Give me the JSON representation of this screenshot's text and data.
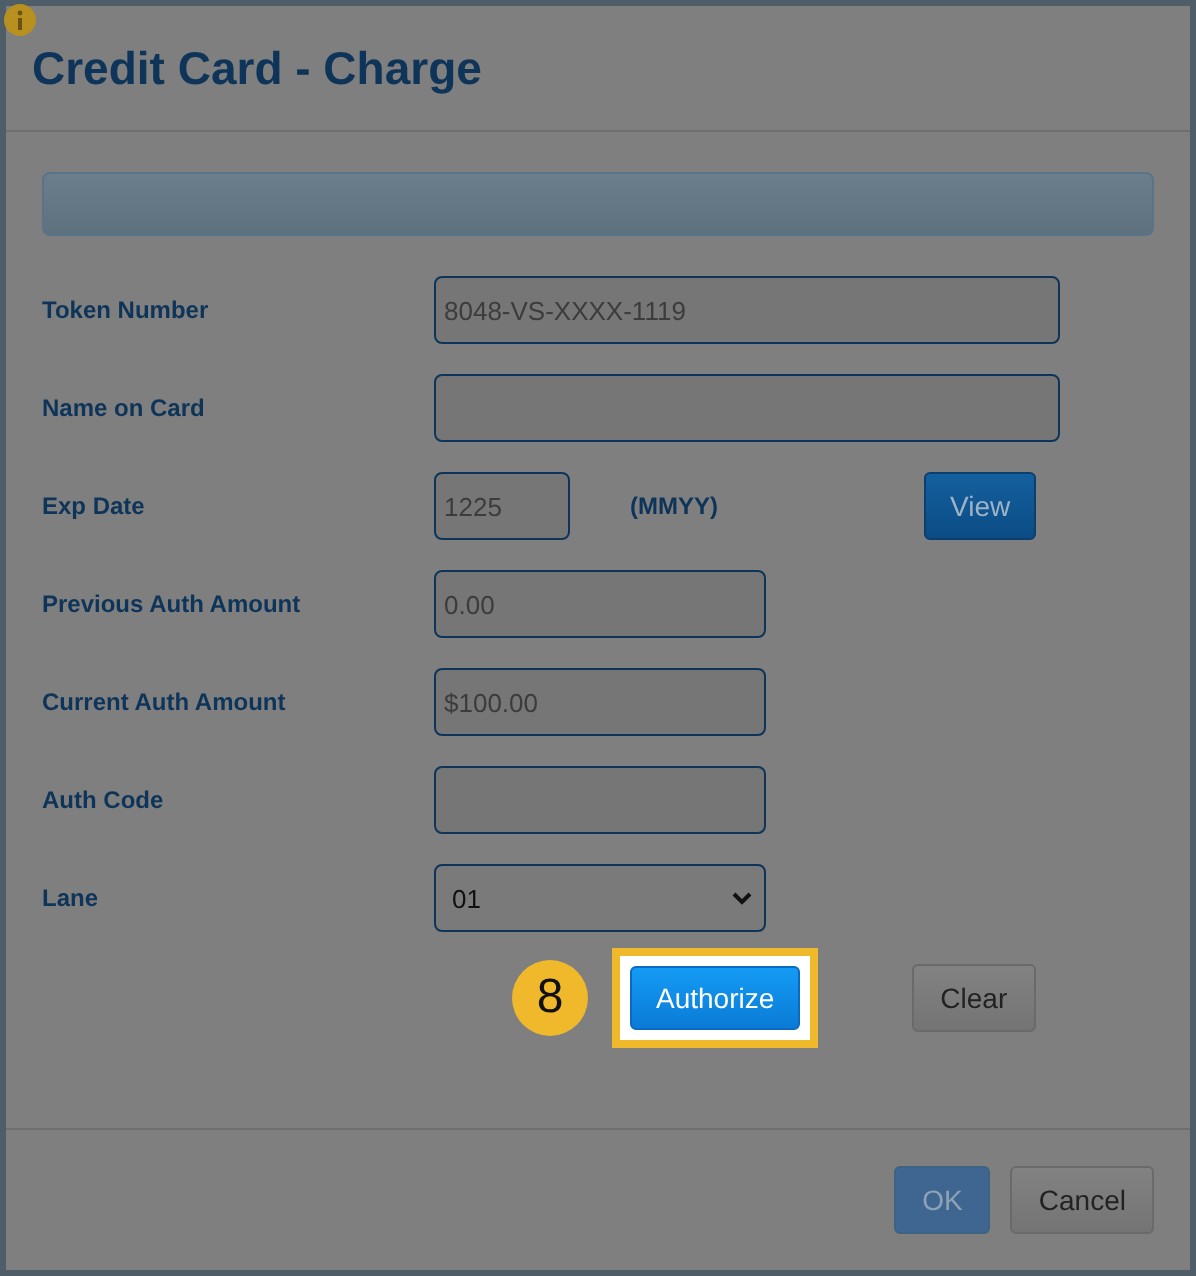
{
  "dialog": {
    "title": "Credit Card - Charge"
  },
  "fields": [
    {
      "kind": "text",
      "label": "Token Number",
      "value": "8048-VS-XXXX-1119"
    },
    {
      "kind": "text",
      "label": "Name on Card"
    },
    {
      "kind": "date",
      "label": "Exp Date",
      "value": "1225",
      "hint": "(MMYY)",
      "button": "View"
    },
    {
      "kind": "text",
      "label": "Previous Auth Amount",
      "value": "0.00"
    },
    {
      "kind": "text",
      "label": "Current Auth Amount",
      "value": "$100.00"
    },
    {
      "kind": "text",
      "label": "Auth Code"
    },
    {
      "kind": "select",
      "label": "Lane",
      "value": "01"
    }
  ],
  "actions": {
    "step": "8",
    "primary": {
      "label": "Authorize",
      "highlighted": true
    },
    "secondary": "Clear"
  },
  "footer": [
    {
      "label": "OK",
      "kind": "primary"
    },
    {
      "label": "Cancel",
      "kind": "default"
    }
  ]
}
